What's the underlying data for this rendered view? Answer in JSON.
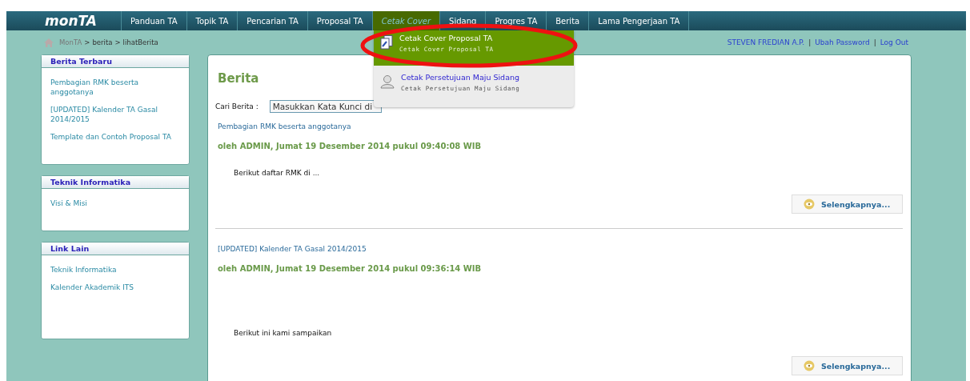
{
  "logo": "monTA",
  "nav": [
    {
      "label": "Panduan TA",
      "selected": false
    },
    {
      "label": "Topik TA",
      "selected": false
    },
    {
      "label": "Pencarian TA",
      "selected": false
    },
    {
      "label": "Proposal TA",
      "selected": false
    },
    {
      "label": "Cetak Cover",
      "selected": true
    },
    {
      "label": "Sidang",
      "selected": false
    },
    {
      "label": "Progres TA",
      "selected": false
    },
    {
      "label": "Berita",
      "selected": false
    },
    {
      "label": "Lama Pengerjaan TA",
      "selected": false
    }
  ],
  "dropdown": [
    {
      "title": "Cetak Cover Proposal TA",
      "subtitle": "Cetak Cover Proposal TA",
      "selected": true
    },
    {
      "title": "Cetak Persetujuan Maju Sidang",
      "subtitle": "Cetak Persetujuan Maju Sidang",
      "selected": false
    }
  ],
  "breadcrumb": {
    "items": [
      "MonTA",
      "berita",
      "lihatBerita"
    ],
    "separator": ">"
  },
  "user_links": {
    "items": [
      "STEVEN FREDIAN A.P.",
      "Ubah Password",
      "Log Out"
    ],
    "separator": "|"
  },
  "sidebar": [
    {
      "title": "Berita Terbaru",
      "links": [
        "Pembagian RMK beserta anggotanya",
        "[UPDATED] Kalender TA Gasal 2014/2015",
        "Template dan Contoh Proposal TA"
      ]
    },
    {
      "title": "Teknik Informatika",
      "links": [
        "Visi & Misi"
      ]
    },
    {
      "title": "Link Lain",
      "links": [
        "Teknik Informatika",
        "Kalender Akademik ITS"
      ]
    }
  ],
  "main": {
    "title": "Berita",
    "search": {
      "label": "Cari Berita :",
      "value": "Masukkan Kata Kunci di"
    },
    "news": [
      {
        "title": "Pembagian RMK beserta anggotanya",
        "byline": "oleh ADMIN, Jumat 19 Desember 2014 pukul 09:40:08 WIB",
        "excerpt": "Berikut daftar RMK di ...",
        "more": "Selengkapnya..."
      },
      {
        "title": "[UPDATED] Kalender TA Gasal 2014/2015",
        "byline": "oleh ADMIN, Jumat 19 Desember 2014 pukul 09:36:14 WIB",
        "excerpt": "Berikut ini kami sampaikan",
        "more": "Selengkapnya..."
      }
    ]
  }
}
